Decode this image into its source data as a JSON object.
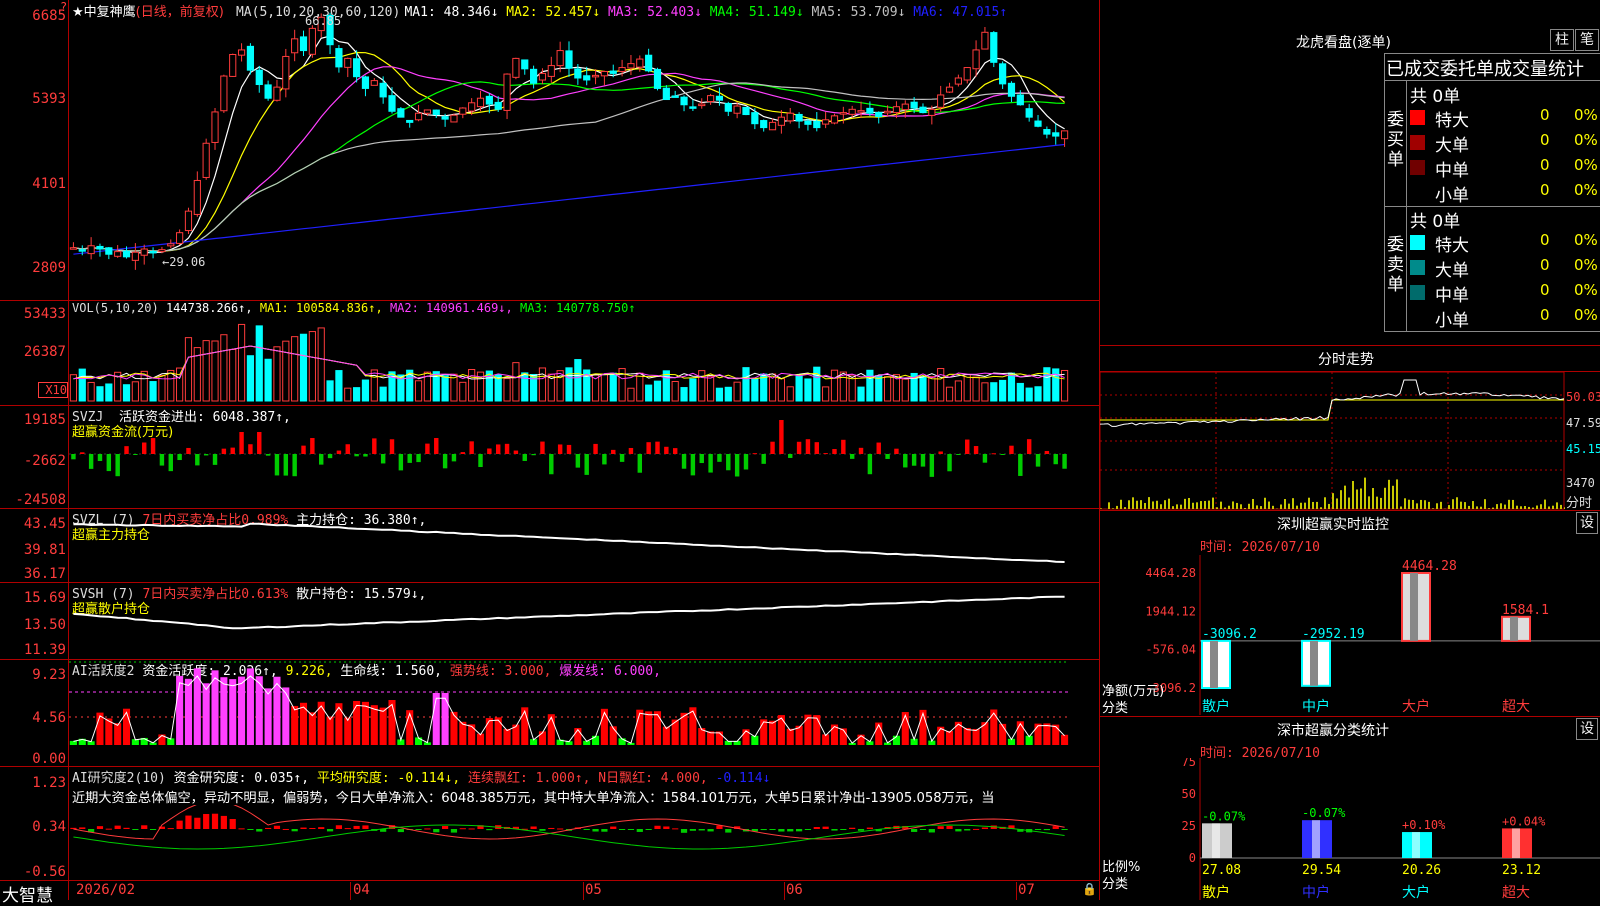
{
  "stock": {
    "name_prefix": "★",
    "name": "中复神鹰",
    "period": "(日线，前复权)"
  },
  "kline": {
    "axis": [
      "6685",
      "5393",
      "4101",
      "2809"
    ],
    "ma_label": "MA(5,10,20,30,60,120)",
    "ma": [
      {
        "label": "MA1: 48.346↓",
        "color": "#ffffff"
      },
      {
        "label": "MA2: 52.457↓",
        "color": "#ffff00"
      },
      {
        "label": "MA3: 52.403↓",
        "color": "#ff40ff"
      },
      {
        "label": "MA4: 51.149↓",
        "color": "#00ff00"
      },
      {
        "label": "MA5: 53.709↓",
        "color": "#c0c0c0"
      },
      {
        "label": "MA6: 47.015↑",
        "color": "#2020ff"
      }
    ],
    "high_label": "66.85",
    "low_label": "←29.06",
    "prices": [
      31.2,
      30.8,
      31.5,
      31.0,
      30.2,
      30.6,
      29.8,
      30.5,
      31.0,
      30.4,
      30.9,
      31.8,
      33.5,
      36.8,
      41.5,
      47.2,
      52.0,
      57.5,
      60.8,
      61.5,
      58.4,
      56.2,
      54.1,
      55.8,
      60.5,
      63.2,
      61.4,
      64.8,
      66.5,
      62.3,
      58.9,
      60.2,
      57.4,
      55.6,
      56.8,
      54.3,
      52.1,
      51.2,
      50.4,
      51.8,
      52.3,
      51.6,
      50.9,
      51.5,
      52.6,
      53.4,
      54.1,
      53.2,
      52.4,
      57.8,
      60.2,
      58.6,
      56.4,
      57.9,
      59.1,
      61.4,
      58.7,
      57.2,
      56.9,
      57.6,
      58.2,
      57.9,
      58.8,
      59.4,
      60.1,
      58.3,
      55.6,
      53.9,
      54.4,
      53.1,
      52.6,
      53.2,
      54.5,
      53.8,
      52.1,
      52.9,
      51.6,
      50.2,
      49.6,
      50.4,
      51.2,
      51.8,
      50.6,
      50.1,
      49.6,
      50.8,
      51.4,
      51.9,
      52.4,
      52.2,
      51.8,
      51.3,
      52.1,
      52.8,
      53.2,
      52.6,
      51.9,
      52.4,
      54.6,
      55.8,
      57.2,
      58.8,
      61.5,
      64.2,
      59.6,
      56.3,
      54.4,
      53.1,
      51.2,
      49.8,
      48.6,
      48.3,
      49.1
    ]
  },
  "vol": {
    "axis": [
      "53433",
      "26387",
      "X10"
    ],
    "label": "VOL(5,10,20)",
    "v": "144738.266↑,",
    "ma1": "MA1: 100584.836↑,",
    "ma2": "MA2: 140961.469↓,",
    "ma3": "MA3: 140778.750↑"
  },
  "svzj": {
    "axis": [
      "19185",
      "-2662",
      "-24508"
    ],
    "label": "SVZJ",
    "v": "活跃资金进出: 6048.387↑,",
    "sub": "超赢资金流(万元)"
  },
  "svzl": {
    "axis": [
      "43.45",
      "39.81",
      "36.17"
    ],
    "label": "SVZL (7)",
    "a": "7日内买卖净占比0.989%",
    "b": "主力持仓: 36.380↑,",
    "sub": "超赢主力持仓"
  },
  "svsh": {
    "axis": [
      "15.69",
      "13.50",
      "11.39"
    ],
    "label": "SVSH (7)",
    "a": "7日内买卖净占比0.613%",
    "b": "散户持仓: 15.579↓,",
    "sub": "超赢散户持仓"
  },
  "ai1": {
    "axis": [
      "9.23",
      "4.56",
      "0.00"
    ],
    "label": "AI活跃度2",
    "a": "资金活跃度: 2.026↑,",
    "b": "9.226,",
    "c": "生命线: 1.560,",
    "d": "强势线: 3.000,",
    "e": "爆发线: 6.000,"
  },
  "ai2": {
    "axis": [
      "1.23",
      "0.34",
      "-0.56"
    ],
    "label": "AI研究度2(10)",
    "a": "资金研究度: 0.035↑,",
    "b": "平均研究度: -0.114↓,",
    "c": "连续飘红: 1.000↑,",
    "d": "N日飘红: 4.000,",
    "e": "-0.114↓",
    "comment": "近期大资金总体偏空，异动不明显，偏弱势，今日大单净流入：6048.385万元，其中特大单净流入：1584.101万元，大单5日累计净出-13905.058万元，当"
  },
  "bottom": {
    "brand": "大智慧",
    "dates": [
      "2026/02",
      "04",
      "05",
      "06",
      "07"
    ]
  },
  "side": {
    "lhb": {
      "title": "龙虎看盘(逐单)",
      "btn1": "柱",
      "btn2": "笔",
      "tabs": "已成交委托单成交量统计"
    },
    "buy": {
      "title": "委买单",
      "total": "共 0单",
      "rows": [
        {
          "name": "特大",
          "v": "0",
          "p": "0%",
          "c": "#ff0000"
        },
        {
          "name": "大单",
          "v": "0",
          "p": "0%",
          "c": "#a00000"
        },
        {
          "name": "中单",
          "v": "0",
          "p": "0%",
          "c": "#700000"
        },
        {
          "name": "小单",
          "v": "0",
          "p": "0%",
          "c": "#000000"
        }
      ]
    },
    "sell": {
      "title": "委卖单",
      "total": "共 0单",
      "rows": [
        {
          "name": "特大",
          "v": "0",
          "p": "0%",
          "c": "#00ffff"
        },
        {
          "name": "大单",
          "v": "0",
          "p": "0%",
          "c": "#008b8b"
        },
        {
          "name": "中单",
          "v": "0",
          "p": "0%",
          "c": "#006b6b"
        },
        {
          "name": "小单",
          "v": "0",
          "p": "0%",
          "c": "#000000"
        }
      ]
    },
    "fs": {
      "title": "分时走势",
      "axis": [
        "50.03",
        "47.59",
        "45.15",
        "3470",
        "分时"
      ]
    },
    "szmon": {
      "title": "深圳超赢实时监控",
      "btn": "设",
      "time": "时间: 2026/07/10",
      "axis": [
        "4464.28",
        "1944.12",
        "-576.04",
        "-3096.2"
      ],
      "ylabel": "净额(万元)",
      "xlabel": "分类",
      "bars": [
        {
          "cat": "散户",
          "value": -3096.2,
          "label": "-3096.2"
        },
        {
          "cat": "中户",
          "value": -2952.19,
          "label": "-2952.19"
        },
        {
          "cat": "大户",
          "value": 4464.28,
          "label": "4464.28"
        },
        {
          "cat": "超大",
          "value": 1584.1,
          "label": "1584.1"
        }
      ]
    },
    "sscls": {
      "title": "深市超赢分类统计",
      "btn": "设",
      "time": "时间: 2026/07/10",
      "axis": [
        "75",
        "50",
        "25",
        "0"
      ],
      "ylabel": "比例%",
      "xlabel": "分类",
      "bars": [
        {
          "cat": "散户",
          "value": 27.08,
          "top": "-0.07%",
          "c": "#cccccc"
        },
        {
          "cat": "中户",
          "value": 29.54,
          "top": "-0.07%",
          "c": "#3030ff"
        },
        {
          "cat": "大户",
          "value": 20.26,
          "top": "+0.10%",
          "c": "#00ffff"
        },
        {
          "cat": "超大",
          "value": 23.12,
          "top": "+0.04%",
          "c": "#ff3030"
        }
      ]
    }
  }
}
